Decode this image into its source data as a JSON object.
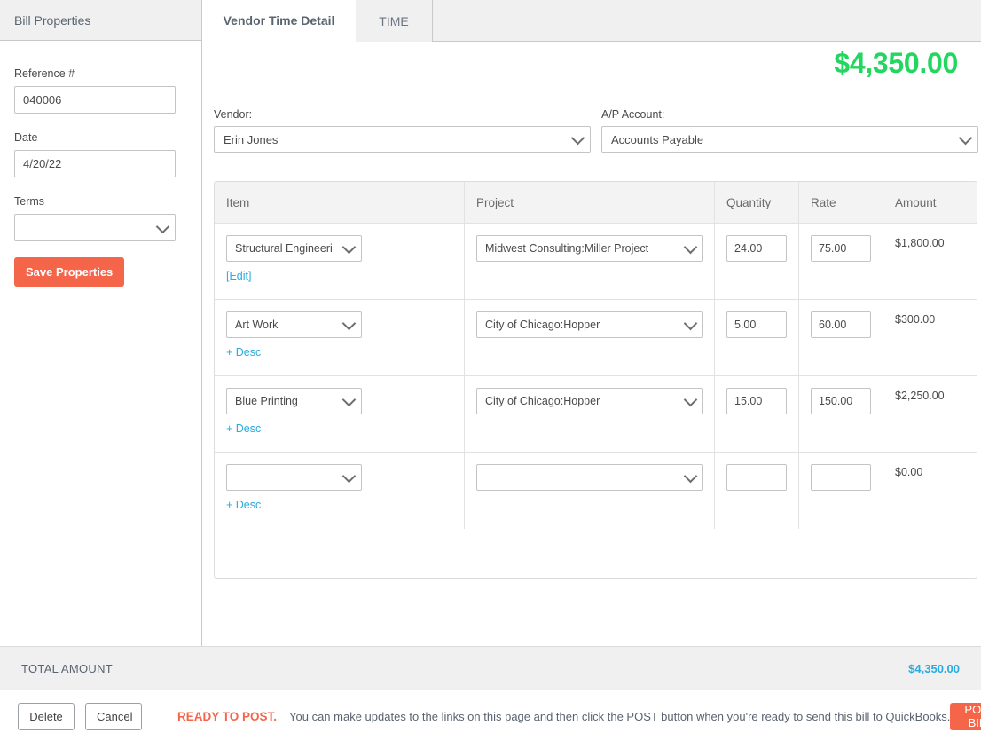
{
  "sidebar": {
    "title": "Bill Properties",
    "fields": [
      {
        "label": "Reference #",
        "value": "040006",
        "type": "text"
      },
      {
        "label": "Date",
        "value": "4/20/22",
        "type": "text"
      },
      {
        "label": "Terms",
        "value": "",
        "type": "select"
      }
    ],
    "save_label": "Save Properties"
  },
  "tabs": [
    {
      "label": "Vendor Time Detail",
      "active": true
    },
    {
      "label": "TIME",
      "active": false
    }
  ],
  "main": {
    "grand_total": "$4,350.00",
    "vendor": {
      "label": "Vendor:",
      "value": "Erin Jones"
    },
    "ap_account": {
      "label": "A/P Account:",
      "value": "Accounts Payable"
    }
  },
  "table": {
    "headers": [
      "Item",
      "Project",
      "Quantity",
      "Rate",
      "Amount"
    ],
    "rows": [
      {
        "item": "Structural Engineeri",
        "project": "Midwest Consulting:Miller Project",
        "quantity": "24.00",
        "rate": "75.00",
        "amount": "$1,800.00",
        "sublink": "[Edit]"
      },
      {
        "item": "Art Work",
        "project": "City of Chicago:Hopper",
        "quantity": "5.00",
        "rate": "60.00",
        "amount": "$300.00",
        "sublink": "+ Desc"
      },
      {
        "item": "Blue Printing",
        "project": "City of Chicago:Hopper",
        "quantity": "15.00",
        "rate": "150.00",
        "amount": "$2,250.00",
        "sublink": "+ Desc"
      },
      {
        "item": "",
        "project": "",
        "quantity": "",
        "rate": "",
        "amount": "$0.00",
        "sublink": "+ Desc"
      }
    ]
  },
  "total_bar": {
    "label": "TOTAL AMOUNT",
    "value": "$4,350.00"
  },
  "footer": {
    "delete_label": "Delete",
    "cancel_label": "Cancel",
    "status_strong": "READY TO POST.",
    "status_text": "You can make updates to the links on this page and then click the POST button when you're ready to send this bill to QuickBooks.",
    "post_label": "POST BILL"
  },
  "colors": {
    "accent_orange": "#f4654a",
    "total_green": "#22d65f",
    "link_blue": "#29abe2"
  }
}
